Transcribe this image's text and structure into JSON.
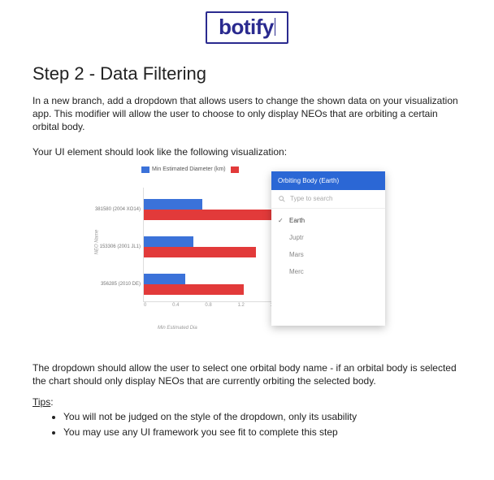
{
  "logo": {
    "text": "botify"
  },
  "title": "Step 2 - Data Filtering",
  "para1": "In a new branch, add a dropdown that allows users to change the shown data on your visualization app. This modifier will allow the user to choose to only display NEOs that are orbiting a certain orbital body.",
  "para2": "Your UI element should look like the following visualization:",
  "chart_data": {
    "type": "bar",
    "orientation": "horizontal",
    "title": "",
    "xlabel": "Min Estimated Dia",
    "ylabel": "NEO Name",
    "xlim": [
      0,
      1.6
    ],
    "xticks": [
      "0",
      "0.4",
      "0.8",
      "1.2",
      "1.6"
    ],
    "categories": [
      "381580 (2004 XO14)",
      "153306 (2001 JL1)",
      "356285 (2010 DE)"
    ],
    "series": [
      {
        "name": "Min Estimated Diameter (km)",
        "color": "#3b72d9",
        "values": [
          0.7,
          0.6,
          0.5
        ]
      },
      {
        "name": "",
        "color": "#e23a3a",
        "values": [
          1.6,
          1.35,
          1.2
        ]
      }
    ]
  },
  "dropdown": {
    "header": "Orbiting Body (Earth)",
    "search_placeholder": "Type to search",
    "selected": "Earth",
    "options": [
      "Earth",
      "Juptr",
      "Mars",
      "Merc"
    ]
  },
  "para3": "The dropdown should allow the user to select one orbital body name - if an orbital body is selected the chart should only display NEOs that are currently orbiting the selected body.",
  "tips_label": "Tips",
  "tips": [
    "You will not be judged on the style of the dropdown, only its usability",
    "You may use any UI framework you see fit to complete this step"
  ]
}
